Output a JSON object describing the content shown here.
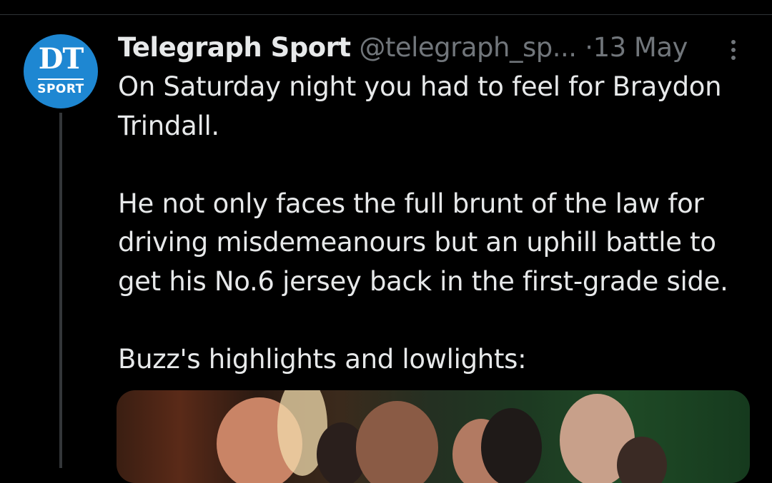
{
  "tweet": {
    "author_name": "Telegraph Sport",
    "handle": "@telegraph_sp...",
    "separator": "·",
    "date": "13 May",
    "avatar": {
      "logo_text": "DT",
      "logo_subtext": "SPORT",
      "color": "#1e87d2"
    },
    "paragraphs": [
      "On Saturday night you had to feel for Braydon Trindall.",
      "He not only faces the full brunt of the law for driving misdemeanours but an uphill battle to get his No.6 jersey back in the first-grade side.",
      "Buzz's highlights and lowlights:"
    ],
    "media": {
      "icon": "photo-of-rugby-league-players"
    }
  },
  "colors": {
    "background": "#000000",
    "primary_text": "#e7e9ea",
    "secondary_text": "#71767b",
    "divider": "#2f3336"
  }
}
